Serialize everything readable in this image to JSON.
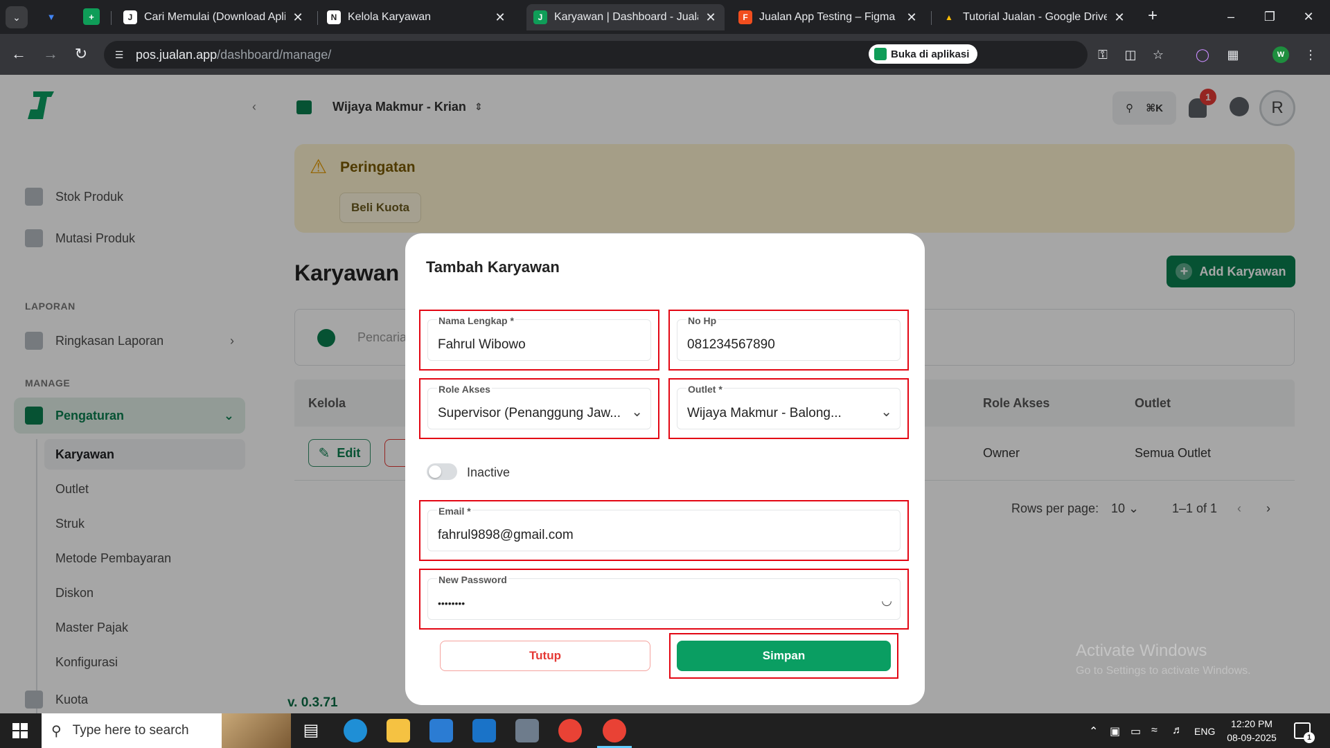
{
  "browser": {
    "tabs": [
      {
        "title": "Cari Memulai (Download Aplikasi)",
        "favicon_color": "#ffffff",
        "favicon_text": "J"
      },
      {
        "title": "Kelola Karyawan",
        "favicon_color": "#ffffff",
        "favicon_text": "N"
      },
      {
        "title": "Karyawan | Dashboard - Jualan",
        "favicon_color": "#0f9d58",
        "favicon_text": "J"
      },
      {
        "title": "Jualan App Testing – Figma",
        "favicon_color": "#f24e1e",
        "favicon_text": "F"
      },
      {
        "title": "Tutorial Jualan - Google Drive",
        "favicon_color": "#fbbc04",
        "favicon_text": "▲"
      }
    ],
    "url_host": "pos.jualan.app",
    "url_path": "/dashboard/manage/",
    "open_app_label": "Buka di aplikasi",
    "profile_initial": "W"
  },
  "app": {
    "store_name": "Wijaya Makmur - Krian",
    "search_shortcut": "⌘K",
    "notification_count": "1",
    "user_initial": "R",
    "sidebar": {
      "items_top": [
        {
          "label": "Stok Produk"
        },
        {
          "label": "Mutasi Produk"
        }
      ],
      "section_laporan": "LAPORAN",
      "laporan_item": "Ringkasan Laporan",
      "section_manage": "MANAGE",
      "pengaturan": "Pengaturan",
      "sub_items": [
        "Karyawan",
        "Outlet",
        "Struk",
        "Metode Pembayaran",
        "Diskon",
        "Master Pajak",
        "Konfigurasi"
      ],
      "kuota": "Kuota"
    },
    "version": "v. 0.3.71",
    "warning": {
      "title": "Peringatan",
      "button": "Beli Kuota"
    },
    "page_title": "Karyawan",
    "add_button": "Add Karyawan",
    "search_placeholder": "Pencarian",
    "table": {
      "headers": {
        "kelola": "Kelola",
        "role": "Role Akses",
        "outlet": "Outlet"
      },
      "row": {
        "edit": "Edit",
        "role": "Owner",
        "outlet": "Semua Outlet"
      }
    },
    "pagination": {
      "rows_label": "Rows per page:",
      "rows_value": "10",
      "range": "1–1 of 1"
    }
  },
  "modal": {
    "title": "Tambah Karyawan",
    "fields": {
      "nama": {
        "label": "Nama Lengkap *",
        "value": "Fahrul Wibowo"
      },
      "hp": {
        "label": "No Hp",
        "value": "081234567890"
      },
      "role": {
        "label": "Role Akses",
        "value": "Supervisor (Penanggung Jaw..."
      },
      "outlet": {
        "label": "Outlet *",
        "value": "Wijaya Makmur - Balong..."
      },
      "email": {
        "label": "Email *",
        "value": "fahrul9898@gmail.com"
      },
      "password": {
        "label": "New Password",
        "value": "••••••••"
      }
    },
    "status_label": "Inactive",
    "close_button": "Tutup",
    "save_button": "Simpan"
  },
  "watermark": {
    "line1": "Activate Windows",
    "line2": "Go to Settings to activate Windows."
  },
  "taskbar": {
    "search_placeholder": "Type here to search",
    "language": "ENG",
    "time": "12:20 PM",
    "date": "08-09-2025",
    "notification_count": "1"
  },
  "colors": {
    "brand": "#0a7f4f",
    "highlight": "#e30613",
    "danger": "#e53935"
  }
}
